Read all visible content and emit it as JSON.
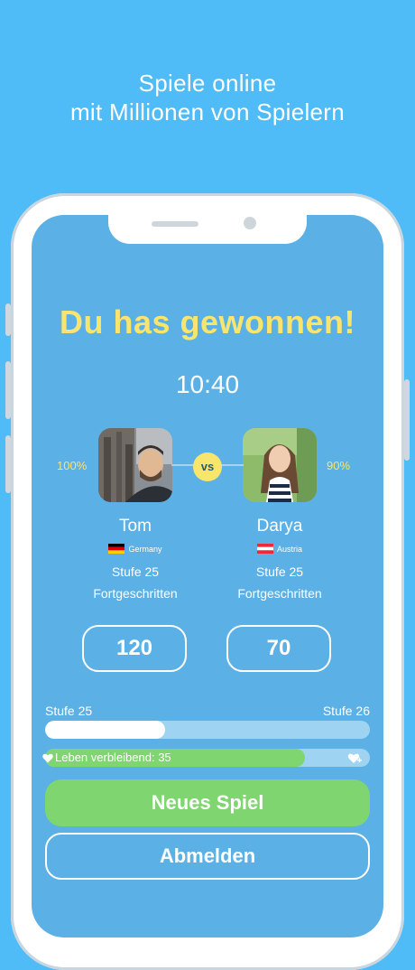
{
  "headline": {
    "line1": "Spiele online",
    "line2": "mit Millionen von Spielern"
  },
  "game": {
    "title": "Du has gewonnen!",
    "timer": "10:40",
    "vs_label": "vs"
  },
  "players": [
    {
      "name": "Tom",
      "country": "Germany",
      "level": "Stufe 25",
      "rank": "Fortgeschritten",
      "percent": "100%",
      "score": "120"
    },
    {
      "name": "Darya",
      "country": "Austria",
      "level": "Stufe 25",
      "rank": "Fortgeschritten",
      "percent": "90%",
      "score": "70"
    }
  ],
  "progress": {
    "current_level": "Stufe 25",
    "next_level": "Stufe 26",
    "fraction": 0.37
  },
  "lives": {
    "label": "Leben verbleibend: 35",
    "fraction": 0.8
  },
  "buttons": {
    "new_game": "Neues Spiel",
    "logout": "Abmelden"
  },
  "colors": {
    "background": "#4fbcf7",
    "screen": "#5bb1e6",
    "accent_yellow": "#f7e56d",
    "accent_green": "#7fd670"
  },
  "icons": {
    "vs_badge": "vs-badge",
    "heart": "heart-icon",
    "heart_add": "heart-add-icon"
  }
}
